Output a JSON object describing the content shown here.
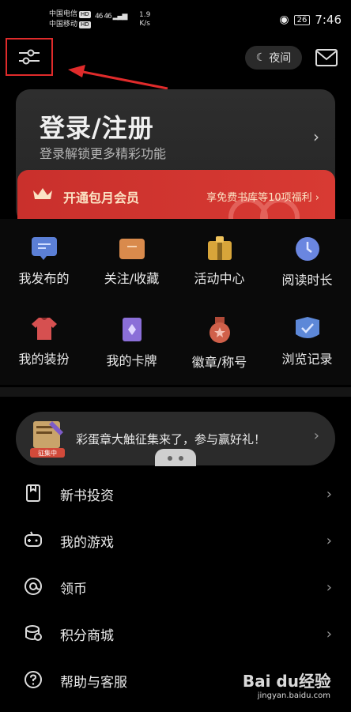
{
  "status_bar": {
    "carrier_1": "中国电信",
    "carrier_2": "中国移动",
    "hd_badge": "HD",
    "network": "46 46",
    "speed_value": "1.9",
    "speed_unit": "K/s",
    "battery": "26",
    "time": "7:46"
  },
  "top_bar": {
    "night_label": "夜间"
  },
  "login": {
    "title": "登录/注册",
    "subtitle": "登录解锁更多精彩功能"
  },
  "vip": {
    "label": "开通包月会员",
    "benefit": "享免费书库等10项福利"
  },
  "grid": [
    {
      "label": "我发布的",
      "icon": "message-icon",
      "color": "#5b7fd6"
    },
    {
      "label": "关注/收藏",
      "icon": "folder-icon",
      "color": "#d98a4c"
    },
    {
      "label": "活动中心",
      "icon": "gift-icon",
      "color": "#d8a53a"
    },
    {
      "label": "阅读时长",
      "icon": "clock-icon",
      "color": "#6a86e0"
    },
    {
      "label": "我的装扮",
      "icon": "tshirt-icon",
      "color": "#d65050"
    },
    {
      "label": "我的卡牌",
      "icon": "card-icon",
      "color": "#8b6fd8"
    },
    {
      "label": "徽章/称号",
      "icon": "medal-icon",
      "color": "#d0604a"
    },
    {
      "label": "浏览记录",
      "icon": "history-icon",
      "color": "#5d88d8"
    }
  ],
  "banner": {
    "text": "彩蛋章大触征集来了，参与赢好礼！",
    "badge_text": "征集中"
  },
  "list": [
    {
      "label": "新书投资",
      "icon": "bookmark-icon"
    },
    {
      "label": "我的游戏",
      "icon": "gamepad-icon"
    },
    {
      "label": "领币",
      "icon": "coin-icon"
    },
    {
      "label": "积分商城",
      "icon": "points-icon"
    },
    {
      "label": "帮助与客服",
      "icon": "help-icon"
    }
  ],
  "watermark": {
    "main": "Bai du经验",
    "sub": "jingyan.baidu.com"
  },
  "colors": {
    "background": "#000000",
    "card": "#2a2a2a",
    "vip_red": "#d3342f",
    "highlight_red": "#e02b2b"
  }
}
